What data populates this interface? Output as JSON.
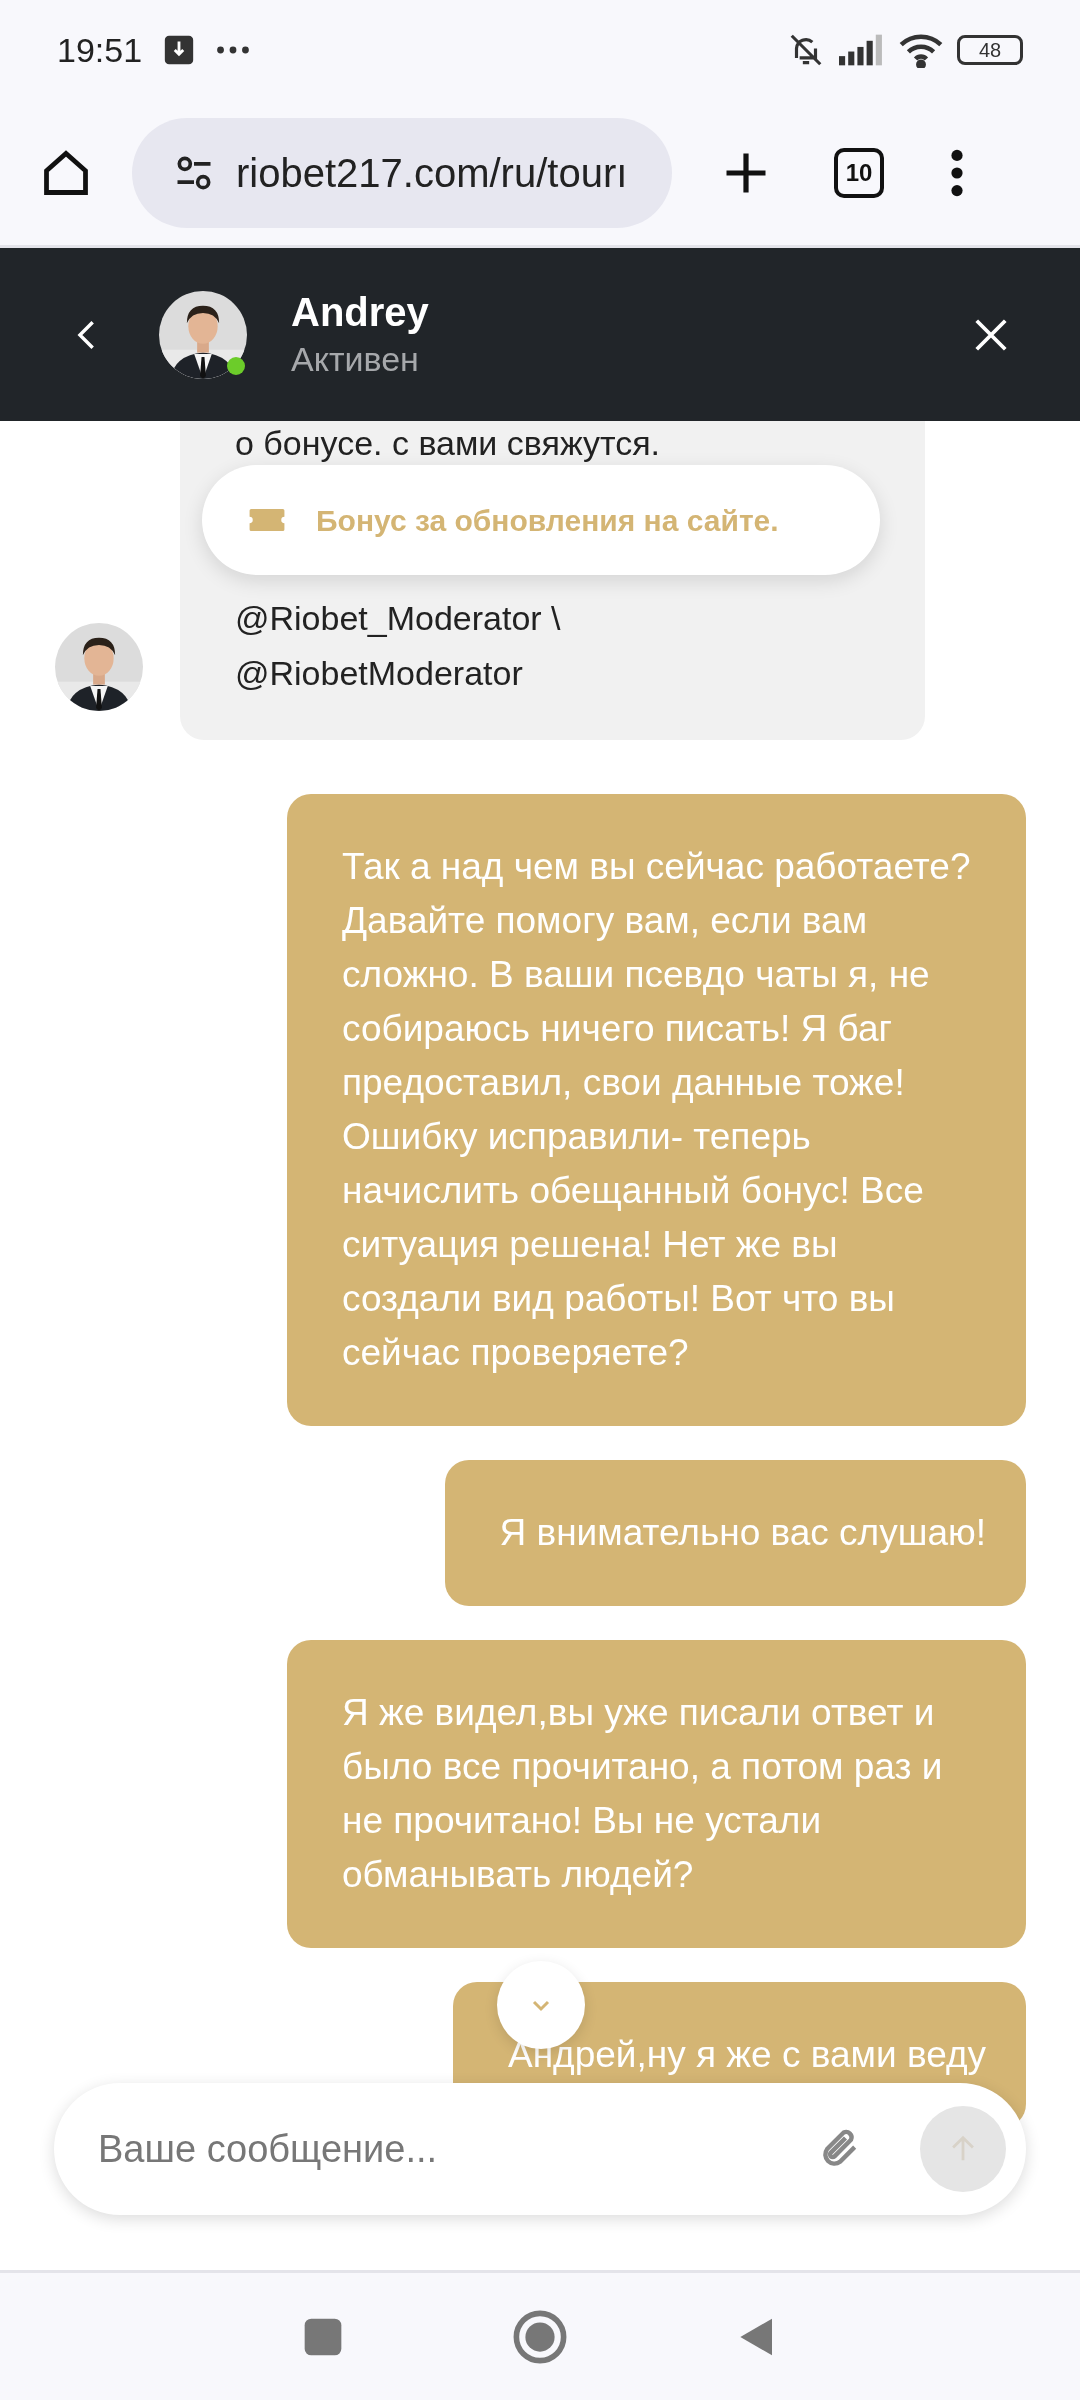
{
  "status_bar": {
    "time": "19:51",
    "battery": "48"
  },
  "browser": {
    "url": "riobet217.com/ru/tourı",
    "tab_count": "10"
  },
  "chat_header": {
    "name": "Andrey",
    "status": "Активен",
    "online": true
  },
  "toast": {
    "text": "Бонус за обновления на сайте."
  },
  "messages": [
    {
      "kind": "agent",
      "lines": [
        "о бонусе. с вами свяжутся.",
        "@Riobet_Moderator \\",
        "@RiobetModerator"
      ]
    },
    {
      "kind": "user",
      "text": "Так а над чем вы сейчас работаете? Давайте помогу вам, если вам сложно. В ваши псевдо чаты я, не собираюсь ничего писать! Я баг предоставил, свои данные тоже! Ошибку исправили- теперь начислить обещанный бонус! Все ситуация решена! Нет же вы создали вид работы! Вот что вы сейчас проверяете?"
    },
    {
      "kind": "user",
      "text": "Я внимательно вас слушаю!"
    },
    {
      "kind": "user",
      "text": "Я же видел,вы уже писали ответ и было все прочитано, а потом раз и не прочитано! Вы не устали обманывать людей?"
    },
    {
      "kind": "user",
      "text": "Андрей,ну я же с вами веду"
    }
  ],
  "composer": {
    "placeholder": "Ваше сообщение...",
    "send_disabled": true
  }
}
